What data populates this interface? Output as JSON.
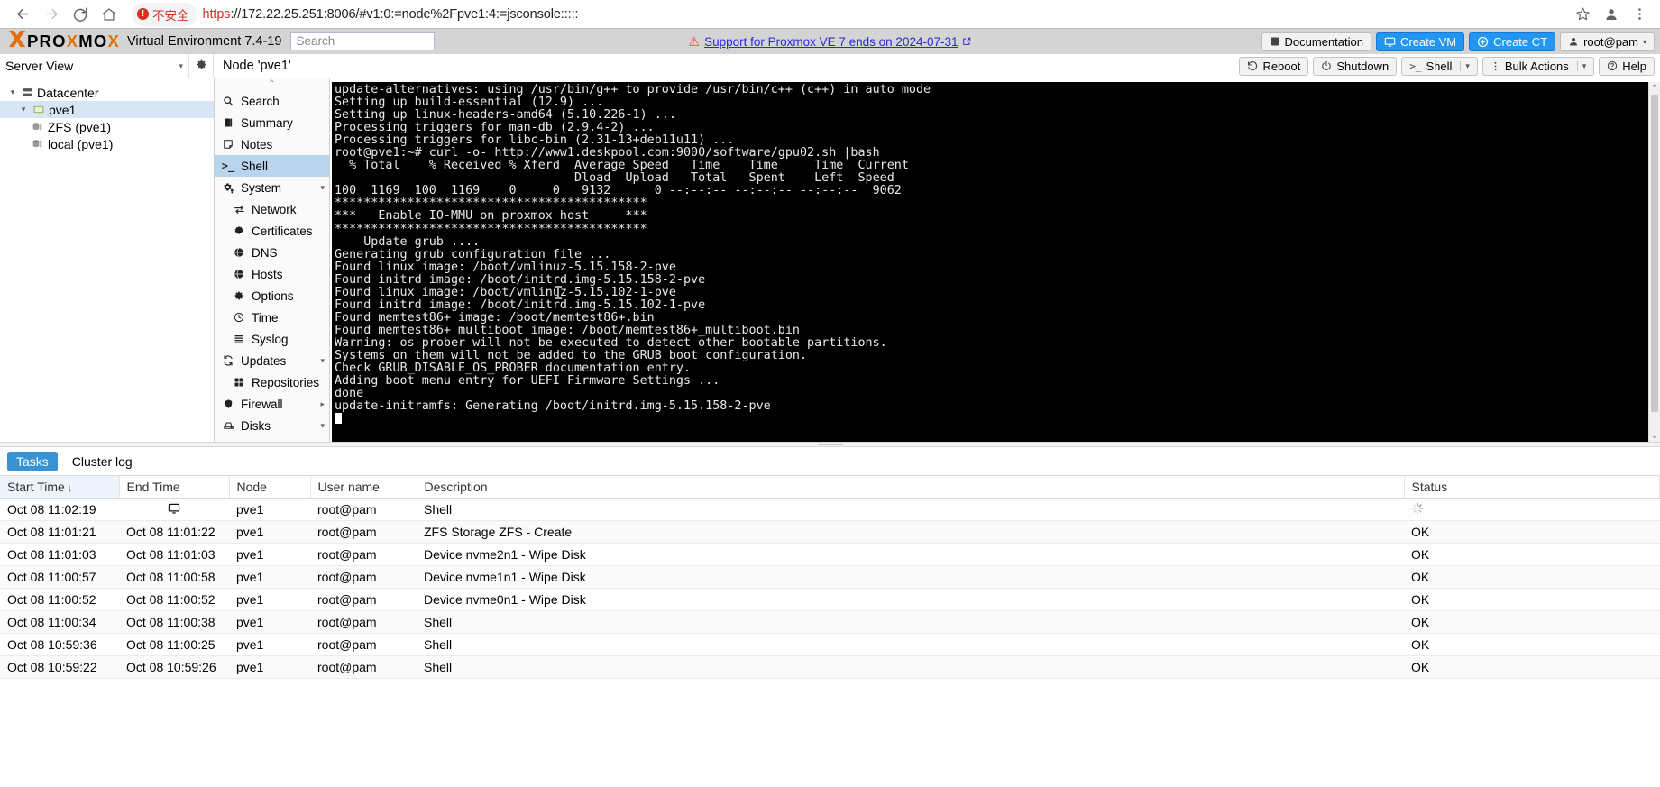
{
  "browser": {
    "back_icon": "back-arrow-icon",
    "forward_icon": "forward-arrow-icon",
    "reload_icon": "reload-icon",
    "home_icon": "home-icon",
    "security_label": "不安全",
    "url_scheme": "https",
    "url_rest": "://172.22.25.251:8006/#v1:0:=node%2Fpve1:4:=jsconsole:::::",
    "star_icon": "bookmark-star-icon",
    "profile_icon": "profile-avatar-icon",
    "menu_icon": "three-dot-menu-icon"
  },
  "header": {
    "logo_x": "X",
    "logo_p": "P",
    "logo_r": "R",
    "logo_o": "O",
    "logo_x2": "X",
    "logo_m": "M",
    "logo_o2": "O",
    "logo_x3": "X",
    "product": "Virtual Environment 7.4-19",
    "search_placeholder": "Search",
    "support_text": "Support for Proxmox VE 7 ends on 2024-07-31",
    "documentation": "Documentation",
    "create_vm": "Create VM",
    "create_ct": "Create CT",
    "user": "root@pam"
  },
  "toolbar": {
    "server_view": "Server View",
    "node_title": "Node 'pve1'",
    "reboot": "Reboot",
    "shutdown": "Shutdown",
    "shell": "Shell",
    "bulk_actions": "Bulk Actions",
    "help": "Help"
  },
  "tree": {
    "datacenter": "Datacenter",
    "node": "pve1",
    "storages": [
      {
        "label": "ZFS (pve1)"
      },
      {
        "label": "local (pve1)"
      }
    ]
  },
  "nav": {
    "items": [
      {
        "label": "Search",
        "icon": "search-icon",
        "level": 0,
        "active": false,
        "arrow": ""
      },
      {
        "label": "Summary",
        "icon": "book-icon",
        "level": 0,
        "active": false,
        "arrow": ""
      },
      {
        "label": "Notes",
        "icon": "note-icon",
        "level": 0,
        "active": false,
        "arrow": ""
      },
      {
        "label": "Shell",
        "icon": "terminal-prompt-icon",
        "level": 0,
        "active": true,
        "arrow": ""
      },
      {
        "label": "System",
        "icon": "gears-icon",
        "level": 0,
        "active": false,
        "arrow": "▾"
      },
      {
        "label": "Network",
        "icon": "network-arrows-icon",
        "level": 1,
        "active": false,
        "arrow": ""
      },
      {
        "label": "Certificates",
        "icon": "certificate-icon",
        "level": 1,
        "active": false,
        "arrow": ""
      },
      {
        "label": "DNS",
        "icon": "globe-icon",
        "level": 1,
        "active": false,
        "arrow": ""
      },
      {
        "label": "Hosts",
        "icon": "globe-icon",
        "level": 1,
        "active": false,
        "arrow": ""
      },
      {
        "label": "Options",
        "icon": "gear-icon",
        "level": 1,
        "active": false,
        "arrow": ""
      },
      {
        "label": "Time",
        "icon": "clock-icon",
        "level": 1,
        "active": false,
        "arrow": ""
      },
      {
        "label": "Syslog",
        "icon": "list-icon",
        "level": 1,
        "active": false,
        "arrow": ""
      },
      {
        "label": "Updates",
        "icon": "refresh-icon",
        "level": 0,
        "active": false,
        "arrow": "▾"
      },
      {
        "label": "Repositories",
        "icon": "repository-icon",
        "level": 1,
        "active": false,
        "arrow": ""
      },
      {
        "label": "Firewall",
        "icon": "shield-icon",
        "level": 0,
        "active": false,
        "arrow": "▸"
      },
      {
        "label": "Disks",
        "icon": "disk-icon",
        "level": 0,
        "active": false,
        "arrow": "▾"
      }
    ]
  },
  "console": {
    "lines": [
      "update-alternatives: using /usr/bin/g++ to provide /usr/bin/c++ (c++) in auto mode",
      "Setting up build-essential (12.9) ...",
      "Setting up linux-headers-amd64 (5.10.226-1) ...",
      "Processing triggers for man-db (2.9.4-2) ...",
      "Processing triggers for libc-bin (2.31-13+deb11u11) ...",
      "root@pve1:~# curl -o- http://www1.deskpool.com:9000/software/gpu02.sh |bash",
      "  % Total    % Received % Xferd  Average Speed   Time    Time     Time  Current",
      "                                 Dload  Upload   Total   Spent    Left  Speed",
      "100  1169  100  1169    0     0   9132      0 --:--:-- --:--:-- --:--:--  9062",
      "",
      "*******************************************",
      "***   Enable IO-MMU on proxmox host     ***",
      "*******************************************",
      "",
      "    Update grub ....",
      "Generating grub configuration file ...",
      "Found linux image: /boot/vmlinuz-5.15.158-2-pve",
      "Found initrd image: /boot/initrd.img-5.15.158-2-pve",
      "Found linux image: /boot/vmlinuz-5.15.102-1-pve",
      "Found initrd image: /boot/initrd.img-5.15.102-1-pve",
      "Found memtest86+ image: /boot/memtest86+.bin",
      "Found memtest86+ multiboot image: /boot/memtest86+_multiboot.bin",
      "Warning: os-prober will not be executed to detect other bootable partitions.",
      "Systems on them will not be added to the GRUB boot configuration.",
      "Check GRUB_DISABLE_OS_PROBER documentation entry.",
      "Adding boot menu entry for UEFI Firmware Settings ...",
      "done",
      "update-initramfs: Generating /boot/initrd.img-5.15.158-2-pve"
    ]
  },
  "tasks": {
    "tab_tasks": "Tasks",
    "tab_cluster_log": "Cluster log",
    "columns": [
      "Start Time",
      "End Time",
      "Node",
      "User name",
      "Description",
      "Status"
    ],
    "sort_arrow": "↓",
    "rows": [
      {
        "start": "Oct 08 11:02:19",
        "end": "",
        "end_icon": "monitor-icon",
        "node": "pve1",
        "user": "root@pam",
        "desc": "Shell",
        "status": "",
        "status_icon": "loading-spinner-icon"
      },
      {
        "start": "Oct 08 11:01:21",
        "end": "Oct 08 11:01:22",
        "end_icon": "",
        "node": "pve1",
        "user": "root@pam",
        "desc": "ZFS Storage ZFS - Create",
        "status": "OK",
        "status_icon": ""
      },
      {
        "start": "Oct 08 11:01:03",
        "end": "Oct 08 11:01:03",
        "end_icon": "",
        "node": "pve1",
        "user": "root@pam",
        "desc": "Device nvme2n1 - Wipe Disk",
        "status": "OK",
        "status_icon": ""
      },
      {
        "start": "Oct 08 11:00:57",
        "end": "Oct 08 11:00:58",
        "end_icon": "",
        "node": "pve1",
        "user": "root@pam",
        "desc": "Device nvme1n1 - Wipe Disk",
        "status": "OK",
        "status_icon": ""
      },
      {
        "start": "Oct 08 11:00:52",
        "end": "Oct 08 11:00:52",
        "end_icon": "",
        "node": "pve1",
        "user": "root@pam",
        "desc": "Device nvme0n1 - Wipe Disk",
        "status": "OK",
        "status_icon": ""
      },
      {
        "start": "Oct 08 11:00:34",
        "end": "Oct 08 11:00:38",
        "end_icon": "",
        "node": "pve1",
        "user": "root@pam",
        "desc": "Shell",
        "status": "OK",
        "status_icon": ""
      },
      {
        "start": "Oct 08 10:59:36",
        "end": "Oct 08 11:00:25",
        "end_icon": "",
        "node": "pve1",
        "user": "root@pam",
        "desc": "Shell",
        "status": "OK",
        "status_icon": ""
      },
      {
        "start": "Oct 08 10:59:22",
        "end": "Oct 08 10:59:26",
        "end_icon": "",
        "node": "pve1",
        "user": "root@pam",
        "desc": "Shell",
        "status": "OK",
        "status_icon": ""
      }
    ]
  },
  "colors": {
    "accent_orange": "#e57000",
    "accent_blue": "#3892d4",
    "selection_blue": "#b9d5ee",
    "danger_red": "#d93025",
    "terminal_bg": "#000000",
    "terminal_fg": "#e9e9e9"
  }
}
